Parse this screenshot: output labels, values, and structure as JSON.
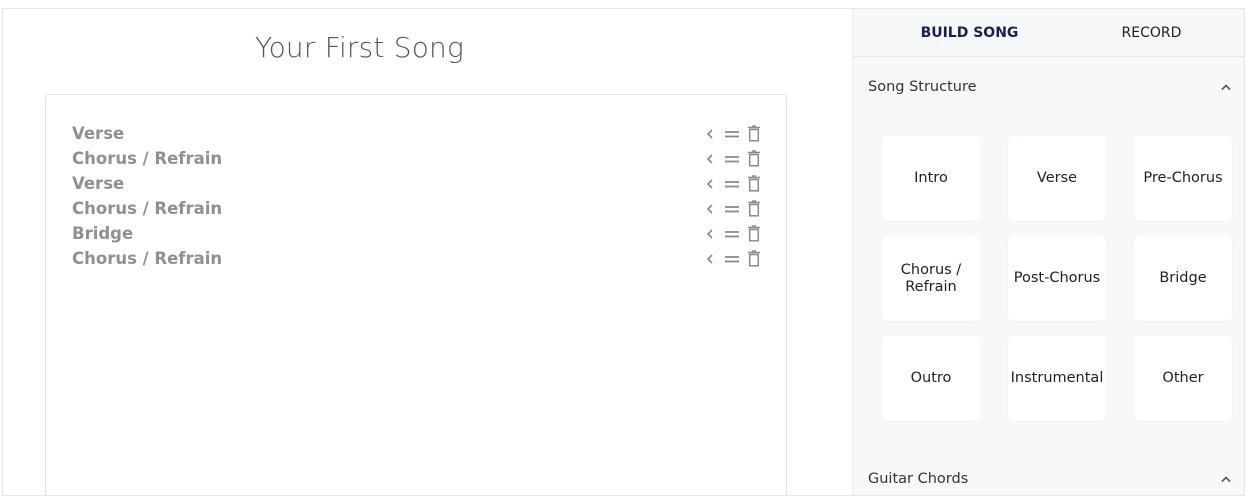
{
  "song": {
    "title": "Your First Song",
    "parts": [
      {
        "name": "Verse"
      },
      {
        "name": "Chorus / Refrain"
      },
      {
        "name": "Verse"
      },
      {
        "name": "Chorus / Refrain"
      },
      {
        "name": "Bridge"
      },
      {
        "name": "Chorus / Refrain"
      }
    ],
    "row_icons": [
      "chevron-left-icon",
      "drag-handle-icon",
      "trash-icon"
    ]
  },
  "tabs": {
    "build": "BUILD SONG",
    "record": "RECORD",
    "active": "build"
  },
  "sections": {
    "song_structure": {
      "title": "Song Structure",
      "expanded": true,
      "tiles": [
        {
          "label": "Intro"
        },
        {
          "label": "Verse"
        },
        {
          "label": "Pre-Chorus"
        },
        {
          "label": "Chorus / Refrain"
        },
        {
          "label": "Post-Chorus"
        },
        {
          "label": "Bridge"
        },
        {
          "label": "Outro"
        },
        {
          "label": "Instrumental"
        },
        {
          "label": "Other"
        }
      ]
    },
    "guitar_chords": {
      "title": "Guitar Chords",
      "expanded": true
    }
  },
  "colors": {
    "accent": "#1a1e5c",
    "part_text": "#909090",
    "panel_bg": "#f7f8fa"
  }
}
